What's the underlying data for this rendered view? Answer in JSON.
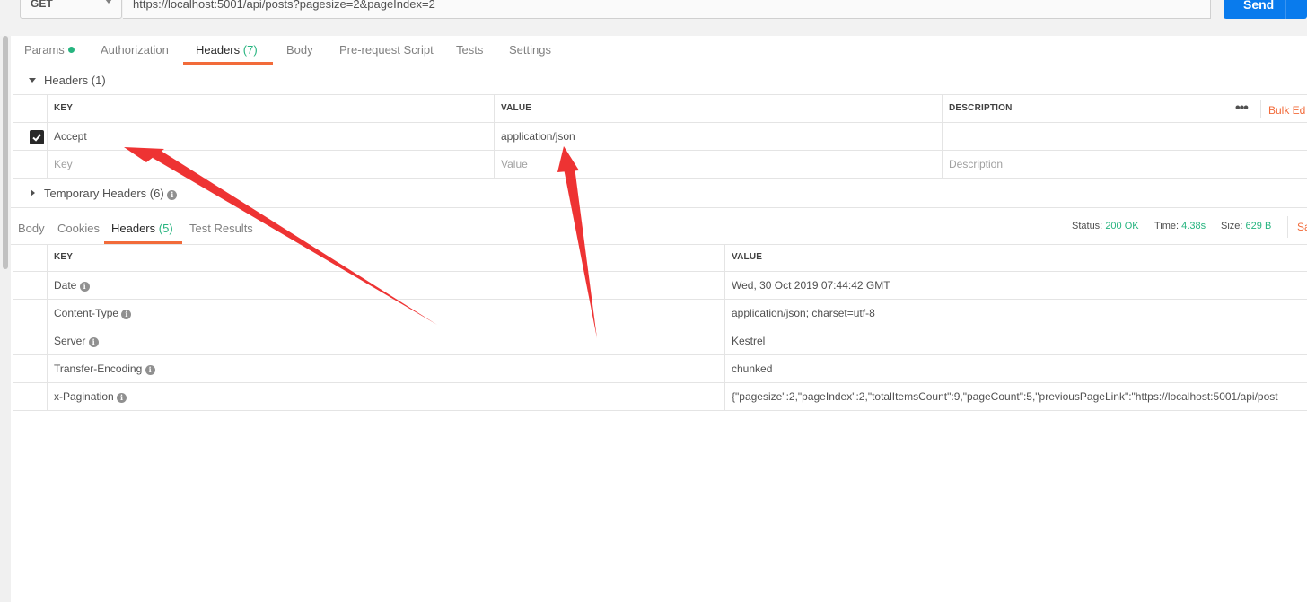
{
  "request": {
    "method": "GET",
    "url": "https://localhost:5001/api/posts?pagesize=2&pageIndex=2",
    "send_label": "Send"
  },
  "request_tabs": {
    "params": "Params",
    "authorization": "Authorization",
    "headers": "Headers",
    "headers_count": "(7)",
    "body": "Body",
    "prerequest": "Pre-request Script",
    "tests": "Tests",
    "settings": "Settings"
  },
  "headers_section": {
    "title": "Headers",
    "count": "(1)",
    "columns": {
      "key": "KEY",
      "value": "VALUE",
      "description": "DESCRIPTION"
    },
    "more": "•••",
    "bulk_edit": "Bulk Ed",
    "rows": [
      {
        "key": "Accept",
        "value": "application/json",
        "description": "",
        "checked": true
      }
    ],
    "placeholders": {
      "key": "Key",
      "value": "Value",
      "description": "Description"
    },
    "temporary_title": "Temporary Headers",
    "temporary_count": "(6)"
  },
  "response_tabs": {
    "body": "Body",
    "cookies": "Cookies",
    "headers": "Headers",
    "headers_count": "(5)",
    "test_results": "Test Results"
  },
  "response_status": {
    "status_label": "Status:",
    "status_value": "200 OK",
    "time_label": "Time:",
    "time_value": "4.38s",
    "size_label": "Size:",
    "size_value": "629 B",
    "save_label": "Sa"
  },
  "response_headers": {
    "columns": {
      "key": "KEY",
      "value": "VALUE"
    },
    "rows": [
      {
        "key": "Date",
        "value": "Wed, 30 Oct 2019 07:44:42 GMT"
      },
      {
        "key": "Content-Type",
        "value": "application/json; charset=utf-8"
      },
      {
        "key": "Server",
        "value": "Kestrel"
      },
      {
        "key": "Transfer-Encoding",
        "value": "chunked"
      },
      {
        "key": "x-Pagination",
        "value": "{\"pagesize\":2,\"pageIndex\":2,\"totalItemsCount\":9,\"pageCount\":5,\"previousPageLink\":\"https://localhost:5001/api/post"
      }
    ]
  },
  "colors": {
    "accent": "#f26b3a",
    "success": "#26b47f",
    "send_blue": "#097bed",
    "annotation_arrow": "#ee3333"
  }
}
